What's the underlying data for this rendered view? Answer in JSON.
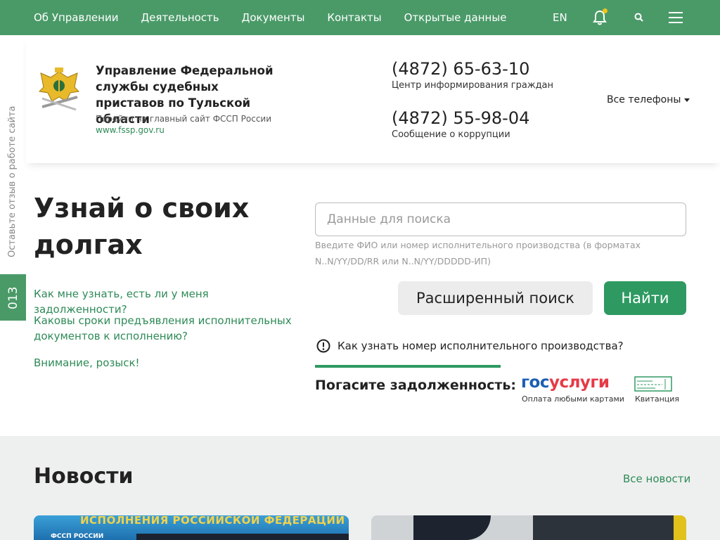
{
  "nav": {
    "items": [
      "Об Управлении",
      "Деятельность",
      "Документы",
      "Контакты",
      "Открытые данные"
    ],
    "lang": "EN"
  },
  "header": {
    "org_title": "Управление Федеральной службы судебных приставов по Тульской области",
    "main_site_text": "Перейти на главный сайт ФССП России",
    "main_site_link": "www.fssp.gov.ru",
    "phones": [
      {
        "number": "(4872) 65-63-10",
        "caption": "Центр информирования граждан"
      },
      {
        "number": "(4872) 55-98-04",
        "caption": "Сообщение о коррупции"
      }
    ],
    "all_phones": "Все телефоны"
  },
  "side": {
    "feedback": "Оставьте отзыв о работе сайта",
    "badge": "013"
  },
  "search": {
    "title": "Узнай о своих долгах",
    "placeholder": "Данные для поиска",
    "hint": "Введите ФИО или номер исполнительного производства (в форматах N..N/YY/DD/RR или N..N/YY/DDDDD-ИП)",
    "advanced_button": "Расширенный поиск",
    "find_button": "Найти",
    "info_text": "Как узнать номер исполнительного производства?",
    "faq": [
      "Как мне узнать, есть ли у меня задолженности?",
      "Каковы сроки предъявления исполнительных документов к исполнению?",
      "Внимание, розыск!"
    ]
  },
  "payment": {
    "label": "Погасите задолженность:",
    "gos_part1": "гос",
    "gos_part2": "услуги",
    "gos_caption": "Оплата любыми картами",
    "receipt_caption": "Квитанция"
  },
  "news": {
    "title": "Новости",
    "all_link": "Все новости",
    "card1_banner": "ИСПОЛНЕНИЯ РОССИЙСКОЙ ФЕДЕРАЦИИ",
    "card1_logo": "ФССП РОССИИ"
  },
  "colors": {
    "brand_green": "#4a9a68",
    "button_green": "#2e9a62",
    "link_green": "#2e8a57"
  }
}
